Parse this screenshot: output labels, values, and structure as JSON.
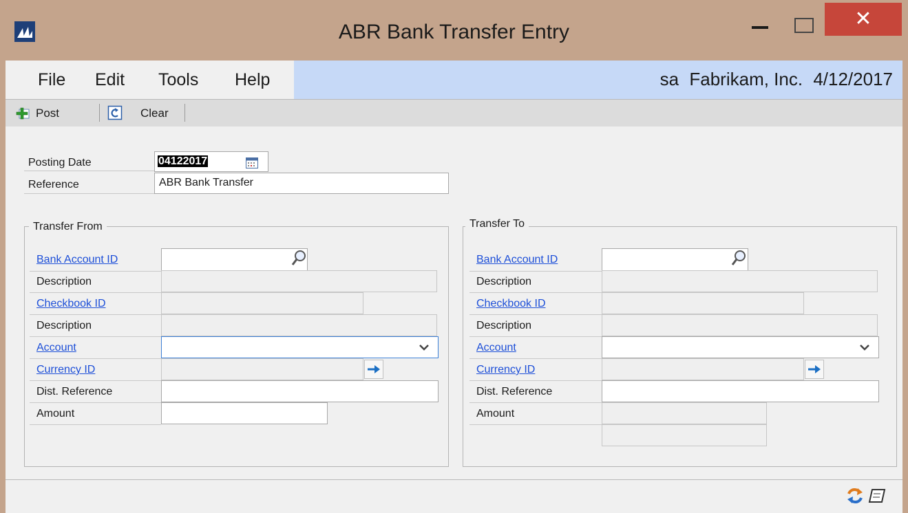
{
  "window": {
    "title": "ABR Bank Transfer Entry",
    "close_glyph": "✕"
  },
  "menu": {
    "items": [
      "File",
      "Edit",
      "Tools",
      "Help"
    ],
    "user": "sa",
    "company": "Fabrikam, Inc.",
    "date": "4/12/2017"
  },
  "toolbar": {
    "post_label": "Post",
    "clear_label": "Clear"
  },
  "header": {
    "posting_date_label": "Posting Date",
    "posting_date_value": "04122017",
    "reference_label": "Reference",
    "reference_value": "ABR Bank Transfer"
  },
  "transfer_from": {
    "title": "Transfer From",
    "bank_account_id_label": "Bank Account ID",
    "bank_account_id_value": "",
    "description_label": "Description",
    "checkbook_id_label": "Checkbook ID",
    "description2_label": "Description",
    "account_label": "Account",
    "currency_id_label": "Currency ID",
    "dist_reference_label": "Dist. Reference",
    "amount_label": "Amount"
  },
  "transfer_to": {
    "title": "Transfer To",
    "bank_account_id_label": "Bank Account ID",
    "description_label": "Description",
    "checkbook_id_label": "Checkbook ID",
    "description2_label": "Description",
    "account_label": "Account",
    "currency_id_label": "Currency ID",
    "dist_reference_label": "Dist. Reference",
    "amount_label": "Amount"
  },
  "colors": {
    "titlebar": "#c4a48c",
    "menu_highlight": "#c6d9f7",
    "link": "#1d4fd8",
    "close_button": "#c6463a"
  }
}
